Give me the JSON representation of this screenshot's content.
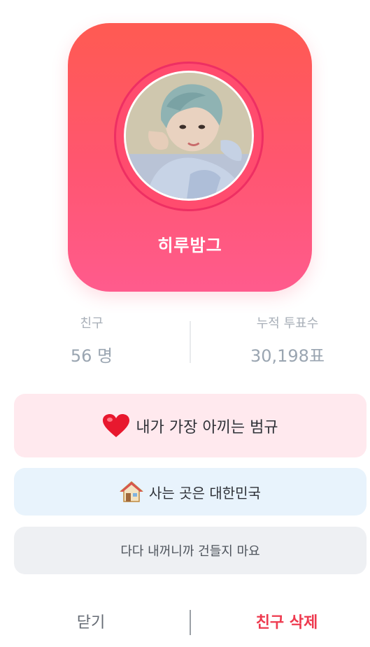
{
  "profile": {
    "name": "히루밤그"
  },
  "stats": {
    "friends_label": "친구",
    "friends_value": "56 명",
    "votes_label": "누적 투표수",
    "votes_value": "30,198표"
  },
  "pills": {
    "love_icon": "heart-icon",
    "love_text": "내가 가장 아끼는 범규",
    "home_icon": "house-icon",
    "home_text": "사는 곳은 대한민국",
    "note_text": "다다 내꺼니까 건들지 마요"
  },
  "footer": {
    "close_label": "닫기",
    "delete_label": "친구 삭제"
  },
  "colors": {
    "card_gradient_top": "#ff5a52",
    "card_gradient_bottom": "#ff5b8d",
    "delete_accent": "#ee3a4f",
    "love_pill_bg": "#ffe9ee",
    "home_pill_bg": "#e8f3fc",
    "note_pill_bg": "#eef0f3"
  }
}
